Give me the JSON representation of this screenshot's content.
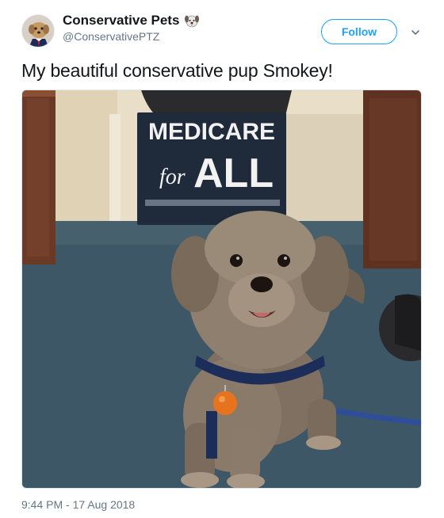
{
  "account": {
    "display_name": "Conservative Pets",
    "handle": "@ConservativePTZ",
    "badge_icon": "dog-face-emoji-icon"
  },
  "follow_button": {
    "label": "Follow"
  },
  "menu_caret": {
    "icon": "chevron-down-icon"
  },
  "tweet": {
    "text": "My beautiful conservative pup Smokey!",
    "timestamp": "9:44 PM - 17 Aug 2018"
  },
  "photo": {
    "sign_lines": [
      "MEDICARE",
      "for",
      "ALL"
    ],
    "colors": {
      "carpet": "#3e5766",
      "wall": "#e9dfc9",
      "wood": "#6b3a26",
      "sign": "#1f2a3a",
      "dog": "#8a7a6a",
      "tag": "#e8731f"
    }
  },
  "colors": {
    "accent": "#1da1f2",
    "muted": "#657786",
    "text": "#14171a"
  }
}
